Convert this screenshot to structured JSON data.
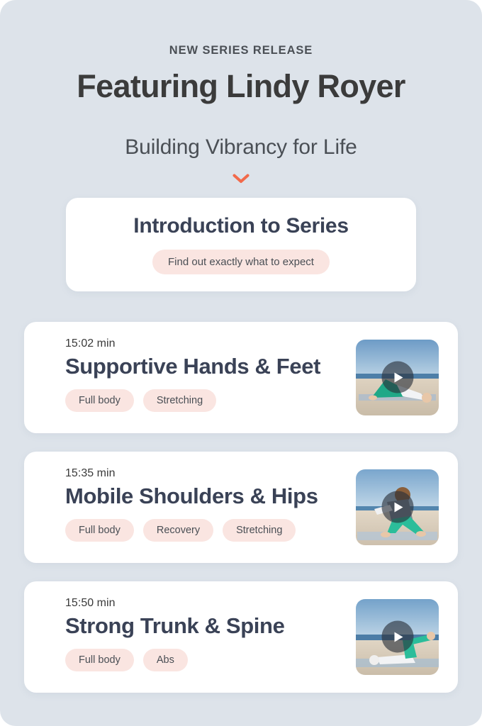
{
  "theme": {
    "page_background": "#dde3ea",
    "card_background": "#ffffff",
    "tag_background": "#fae5e1",
    "title_color": "#3a4256",
    "accent_chevron": "#f26a4b"
  },
  "header": {
    "eyebrow": "NEW SERIES RELEASE",
    "headline": "Featuring Lindy Royer",
    "subhead": "Building Vibrancy for Life",
    "chevron_icon": "chevron-down-icon"
  },
  "intro_card": {
    "title": "Introduction to Series",
    "pill_label": "Find out exactly what to expect"
  },
  "videos": [
    {
      "duration": "15:02 min",
      "title": "Supportive Hands & Feet",
      "tags": [
        "Full body",
        "Stretching"
      ],
      "thumbnail_alt": "beach-bridge-pose-thumbnail",
      "play_icon": "play-icon"
    },
    {
      "duration": "15:35 min",
      "title": "Mobile Shoulders & Hips",
      "tags": [
        "Full body",
        "Recovery",
        "Stretching"
      ],
      "thumbnail_alt": "beach-kneeling-lunge-thumbnail",
      "play_icon": "play-icon"
    },
    {
      "duration": "15:50 min",
      "title": "Strong Trunk & Spine",
      "tags": [
        "Full body",
        "Abs"
      ],
      "thumbnail_alt": "beach-supine-legs-raised-thumbnail",
      "play_icon": "play-icon"
    }
  ]
}
